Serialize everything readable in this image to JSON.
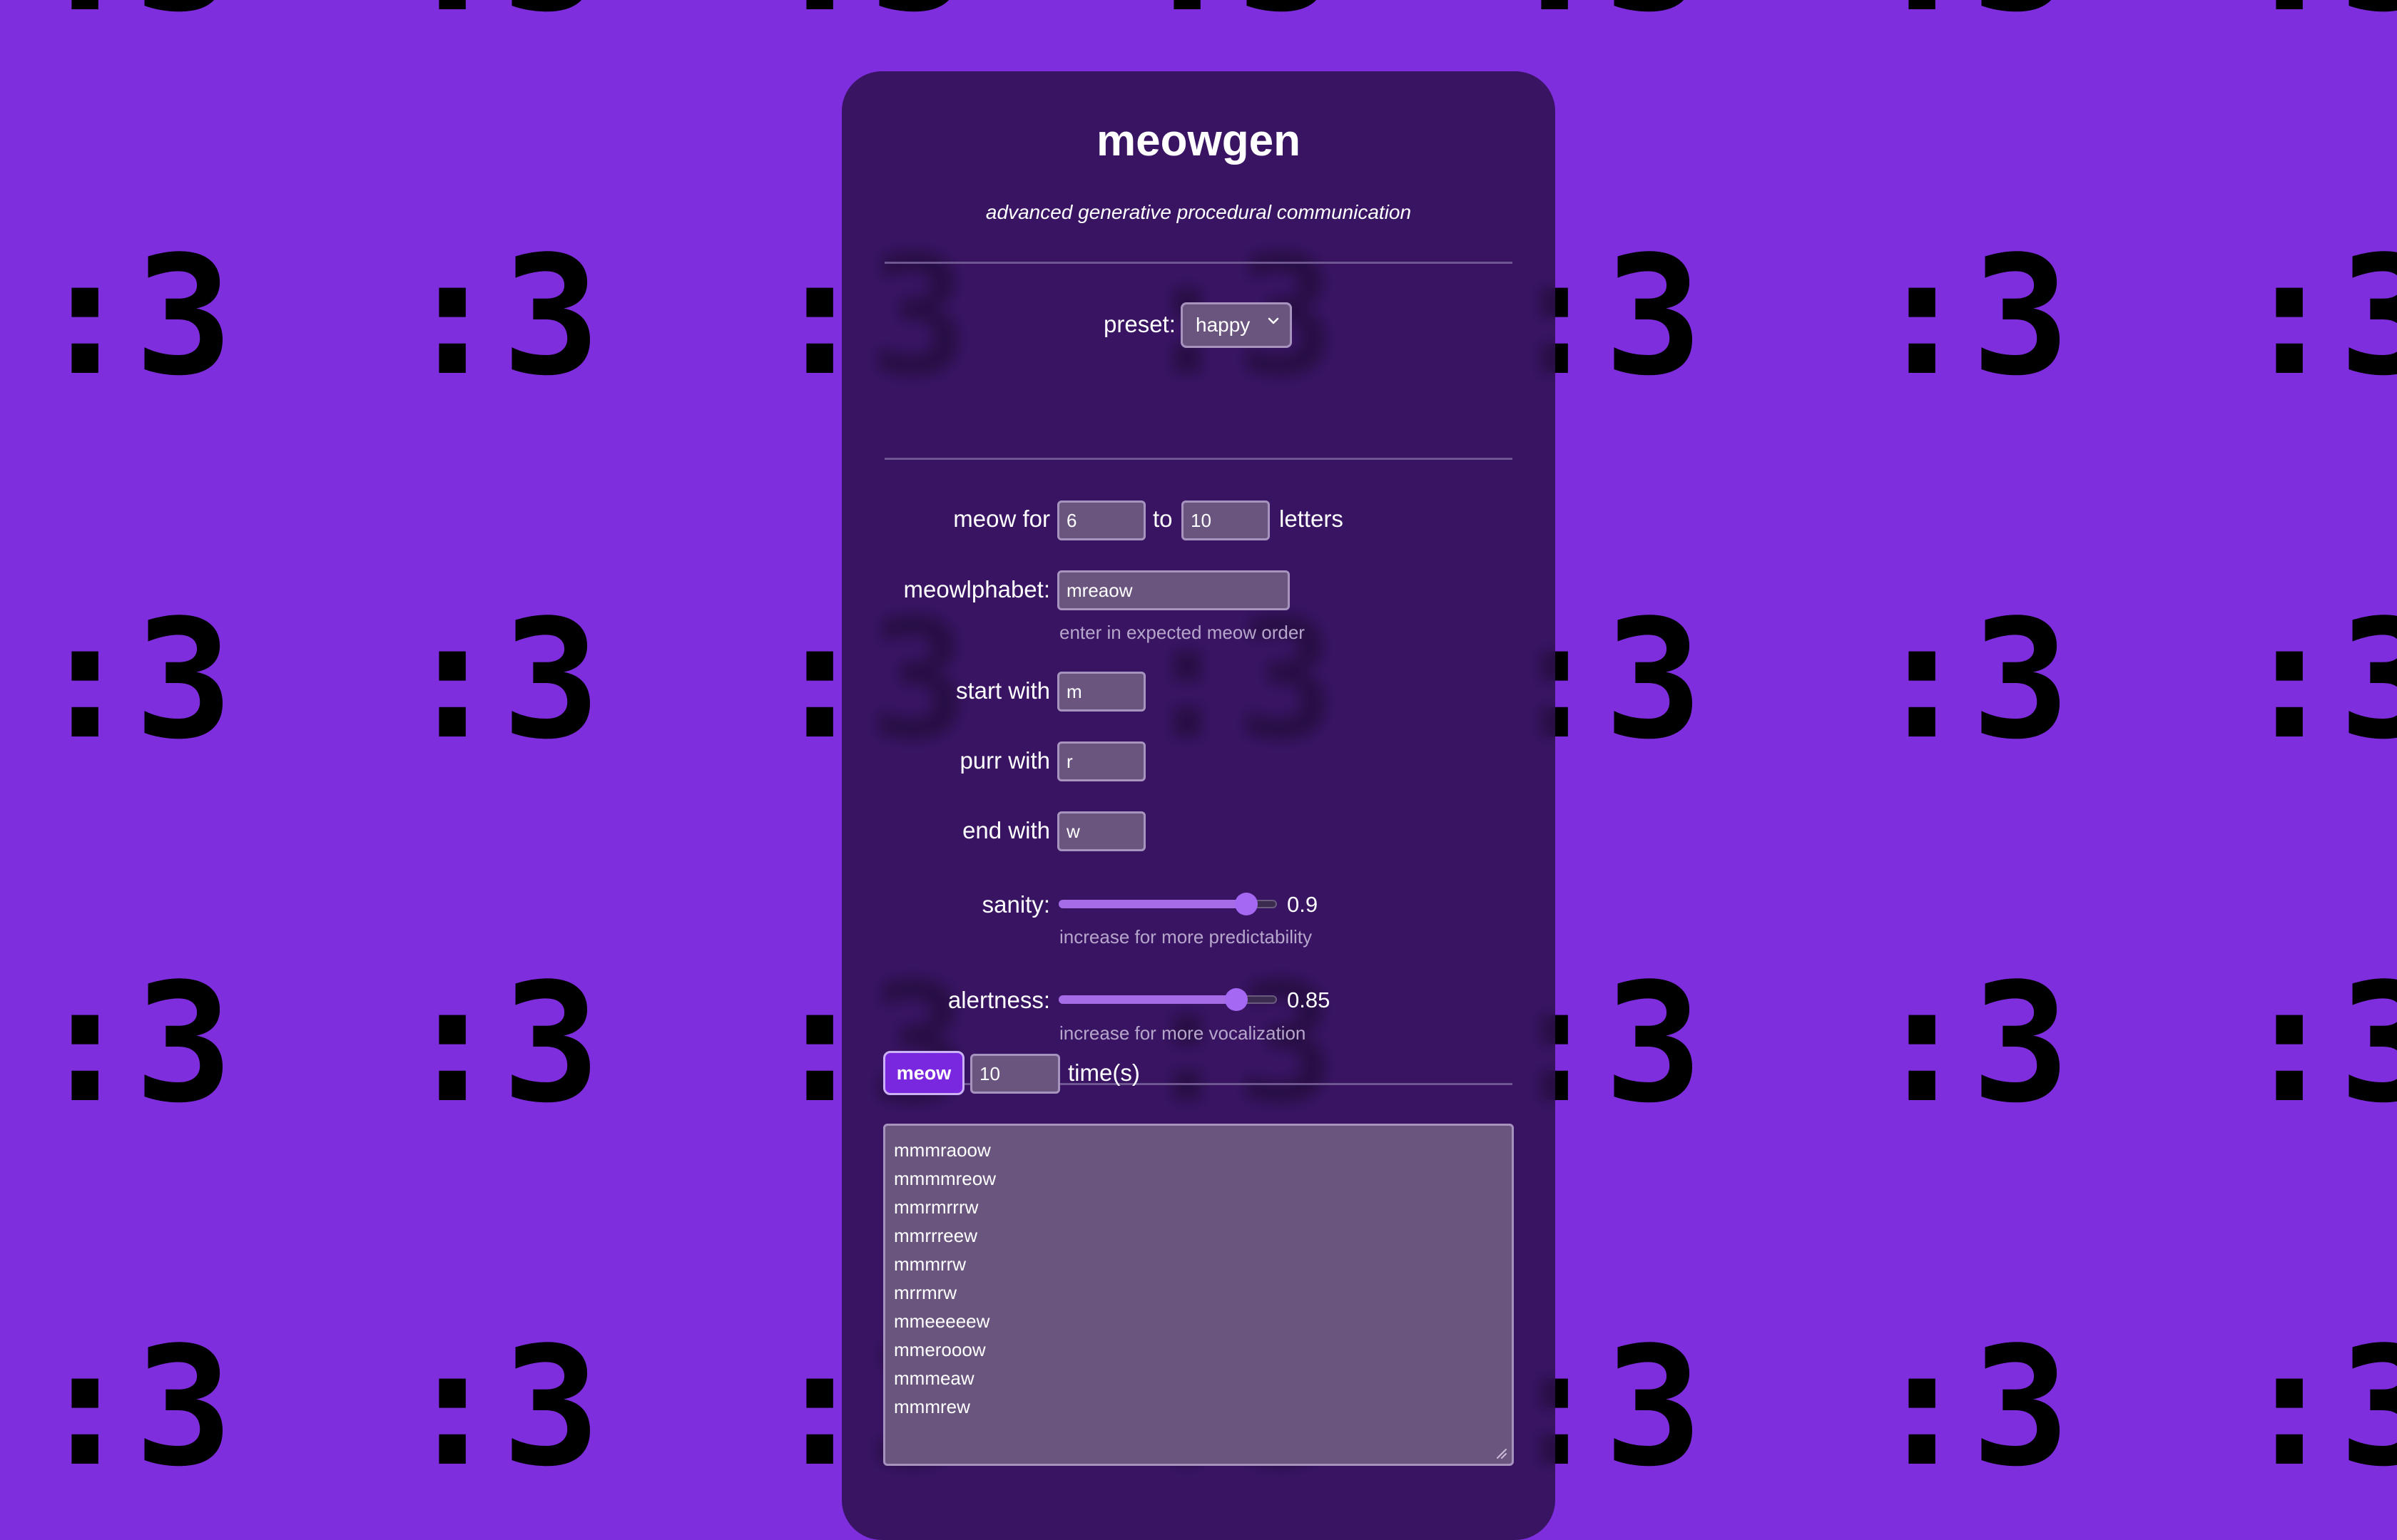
{
  "background": {
    "glyph": ":3",
    "color": "#7e2edc"
  },
  "app": {
    "title": "meowgen",
    "subtitle": "advanced generative procedural communication"
  },
  "preset": {
    "label": "preset:",
    "selected": "happy"
  },
  "length": {
    "label_prefix": "meow for",
    "min": "6",
    "label_mid": "to",
    "max": "10",
    "label_suffix": "letters"
  },
  "meowlphabet": {
    "label": "meowlphabet:",
    "value": "mreaow",
    "hint": "enter in expected meow order"
  },
  "start_with": {
    "label": "start with",
    "value": "m"
  },
  "purr_with": {
    "label": "purr with",
    "value": "r"
  },
  "end_with": {
    "label": "end with",
    "value": "w"
  },
  "sanity": {
    "label": "sanity:",
    "value": 0.9,
    "display": "0.9",
    "hint": "increase for more predictability"
  },
  "alertness": {
    "label": "alertness:",
    "value": 0.85,
    "display": "0.85",
    "hint": "increase for more vocalization"
  },
  "generate": {
    "button_label": "meow",
    "count": "10",
    "suffix": "time(s)"
  },
  "output": {
    "lines": [
      "mmmraoow",
      "mmmmreow",
      "mmrmrrrw",
      "mmrrreew",
      "mmmrrw",
      "mrrmrw",
      "mmeeeeew",
      "mmerooow",
      "mmmeaw",
      "mmmrew"
    ]
  },
  "colors": {
    "accent": "#7a28e0",
    "slider": "#a468f2",
    "card": "#2d104e"
  }
}
